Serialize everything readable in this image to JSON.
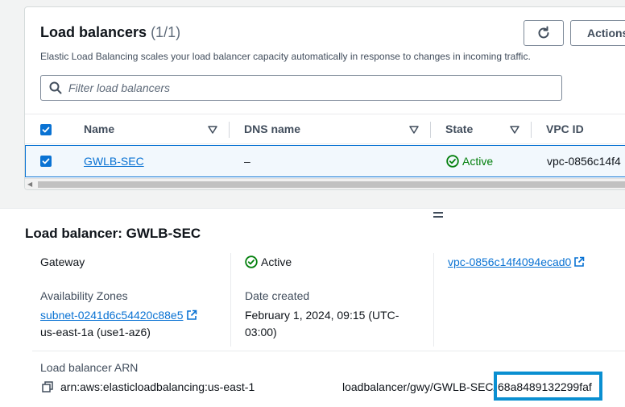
{
  "list": {
    "title": "Load balancers",
    "count": "(1/1)",
    "description": "Elastic Load Balancing scales your load balancer capacity automatically in response to changes in incoming traffic.",
    "actions_label": "Actions",
    "search_placeholder": "Filter load balancers",
    "columns": [
      "Name",
      "DNS name",
      "State",
      "VPC ID"
    ],
    "rows": [
      {
        "name": "GWLB-SEC",
        "dns": "–",
        "state": "Active",
        "vpc": "vpc-0856c14f4"
      }
    ]
  },
  "details": {
    "title": "Load balancer: GWLB-SEC",
    "type_value": "Gateway",
    "status_value": "Active",
    "vpc_link": "vpc-0856c14f4094ecad0",
    "az_label": "Availability Zones",
    "subnet_link": "subnet-0241d6c54420c88e5",
    "az_value": "us-east-1a (use1-az6)",
    "date_label": "Date created",
    "date_line1": "February 1, 2024, 09:15 (UTC-",
    "date_line2": "03:00)",
    "arn_label": "Load balancer ARN",
    "arn_prefix": "arn:aws:elasticloadbalancing:us-east-1",
    "arn_middle": "loadbalancer/gwy/GWLB-SEC/",
    "arn_suffix": "68a8489132299faf"
  },
  "colors": {
    "accent": "#0972d3",
    "success": "#037f0c",
    "highlight": "#0a8fd1"
  }
}
